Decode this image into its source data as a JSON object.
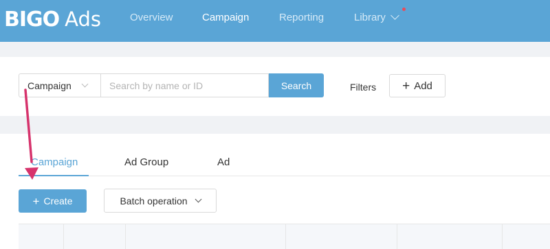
{
  "brand": {
    "name_bold": "BIGO",
    "name_light": "Ads"
  },
  "nav": {
    "items": [
      {
        "label": "Overview",
        "active": false
      },
      {
        "label": "Campaign",
        "active": true
      },
      {
        "label": "Reporting",
        "active": false
      },
      {
        "label": "Library",
        "active": false,
        "has_dropdown": true,
        "notification": true
      }
    ]
  },
  "search": {
    "type_value": "Campaign",
    "placeholder": "Search by name or ID",
    "value": "",
    "button_label": "Search"
  },
  "filters": {
    "label": "Filters",
    "add_label": "Add"
  },
  "tabs": [
    {
      "label": "Campaign",
      "active": true
    },
    {
      "label": "Ad Group",
      "active": false
    },
    {
      "label": "Ad",
      "active": false
    }
  ],
  "actions": {
    "create_label": "Create",
    "batch_label": "Batch operation"
  },
  "icons": {
    "dropdown": "chevron-down-icon",
    "add": "plus-icon",
    "annotation": "arrow-down-icon"
  },
  "colors": {
    "primary": "#5aa5d6",
    "annotation_arrow": "#d6336c",
    "notification": "#e84c5a"
  }
}
